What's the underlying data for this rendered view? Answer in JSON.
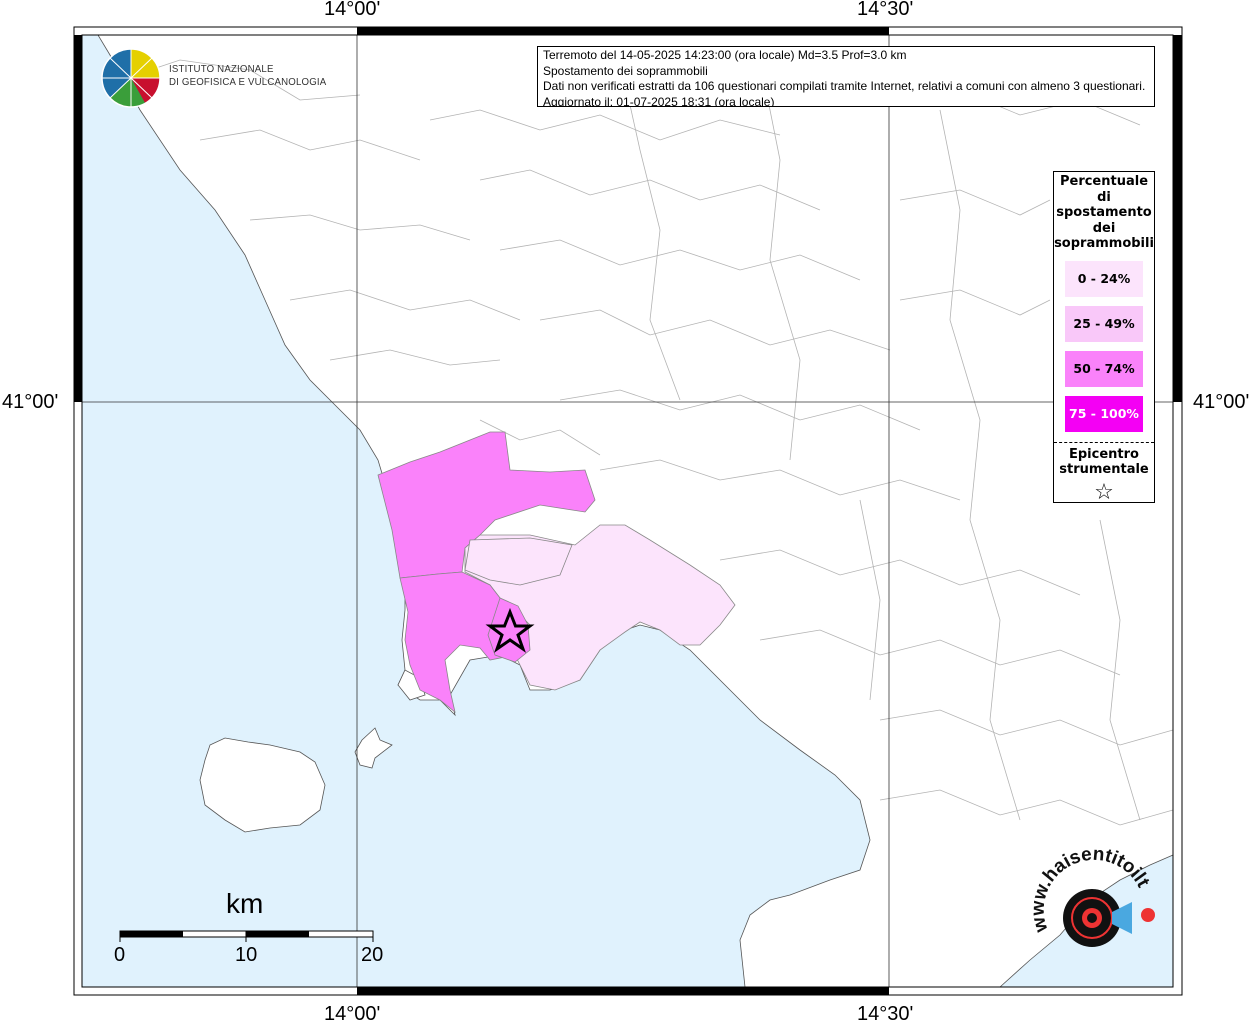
{
  "coordinates": {
    "top_left_lon": "14°00'",
    "top_right_lon": "14°30'",
    "bottom_left_lon": "14°00'",
    "bottom_right_lon": "14°30'",
    "left_lat": "41°00'",
    "right_lat": "41°00'"
  },
  "logo": {
    "line1": "ISTITUTO NAZIONALE",
    "line2": "DI GEOFISICA E VULCANOLOGIA"
  },
  "info": {
    "line1": "Terremoto del 14-05-2025 14:23:00 (ora locale) Md=3.5 Prof=3.0 km",
    "line2": "Spostamento dei soprammobili",
    "line3": "Dati non verificati estratti da 106 questionari compilati tramite Internet, relativi a comuni con almeno 3 questionari.",
    "line4": "Aggiornato il: 01-07-2025 18:31 (ora locale)"
  },
  "legend": {
    "title_lines": [
      "Percentuale",
      "di",
      "spostamento",
      "dei",
      "soprammobili"
    ],
    "classes": [
      {
        "label": "0 - 24%",
        "color": "#fce4fc"
      },
      {
        "label": "25 - 49%",
        "color": "#f9c8f9"
      },
      {
        "label": "50 - 74%",
        "color": "#fa82fa"
      },
      {
        "label": "75 - 100%",
        "color": "#f400f4"
      }
    ],
    "epicenter_lines": [
      "Epicentro",
      "strumentale"
    ],
    "epicenter_symbol": "☆"
  },
  "scale": {
    "unit": "km",
    "ticks": [
      "0",
      "10",
      "20"
    ]
  },
  "watermark": {
    "text": "www.haisentitoilterremoto.it"
  },
  "colors": {
    "sea": "#e0f2fd",
    "land": "#ffffff",
    "borders": "#b3b3b3"
  }
}
